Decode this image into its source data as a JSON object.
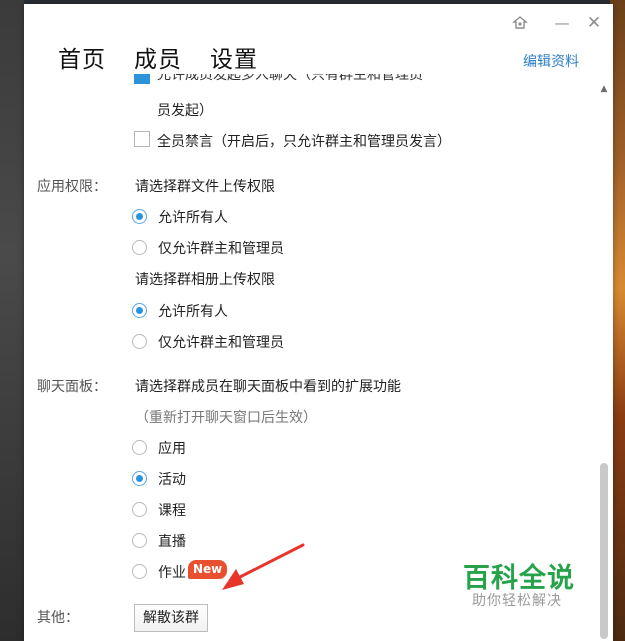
{
  "window": {
    "controls": {
      "skin_icon": "skin-icon",
      "minimize_symbol": "—",
      "close_symbol": "✕"
    },
    "tabs": [
      {
        "label": "首页"
      },
      {
        "label": "成员"
      },
      {
        "label": "设置"
      }
    ],
    "edit_link": "编辑资料"
  },
  "settings": {
    "partial_top_checkbox": {
      "text": "允许成员发起多人聊天（只有群主和管理员",
      "continuation": "员发起）",
      "checked": true
    },
    "mute_all": {
      "label": "全员禁言（开启后，只允许群主和管理员发言）",
      "checked": false
    },
    "app_permission": {
      "section_label": "应用权限：",
      "file_upload_prompt": "请选择群文件上传权限",
      "file_upload_options": [
        {
          "label": "允许所有人",
          "selected": true
        },
        {
          "label": "仅允许群主和管理员",
          "selected": false
        }
      ],
      "album_upload_prompt": "请选择群相册上传权限",
      "album_upload_options": [
        {
          "label": "允许所有人",
          "selected": true
        },
        {
          "label": "仅允许群主和管理员",
          "selected": false
        }
      ]
    },
    "chat_panel": {
      "section_label": "聊天面板：",
      "prompt": "请选择群成员在聊天面板中看到的扩展功能",
      "hint": "（重新打开聊天窗口后生效）",
      "options": [
        {
          "label": "应用",
          "selected": false
        },
        {
          "label": "活动",
          "selected": true
        },
        {
          "label": "课程",
          "selected": false
        },
        {
          "label": "直播",
          "selected": false
        },
        {
          "label": "作业",
          "selected": false,
          "badge": "New"
        }
      ]
    },
    "other": {
      "section_label": "其他：",
      "dissolve_button": "解散该群"
    }
  },
  "colors": {
    "accent": "#2c93db",
    "link": "#2d7ec9",
    "badge": "#e8502f",
    "annotation_arrow": "#e8352c",
    "watermark": "#26a34a"
  },
  "watermark": {
    "title": "百科全说",
    "subtitle": "助你轻松解决"
  }
}
